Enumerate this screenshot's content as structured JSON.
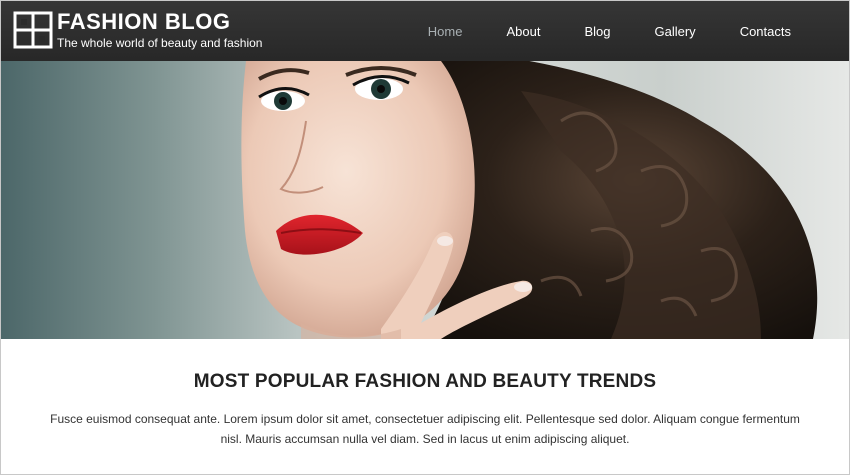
{
  "brand": {
    "title": "FASHION  BLOG",
    "tagline": "The whole world of beauty and fashion",
    "logo_icon": "fb-monogram-icon"
  },
  "nav": {
    "items": [
      {
        "label": "Home",
        "active": true
      },
      {
        "label": "About",
        "active": false
      },
      {
        "label": "Blog",
        "active": false
      },
      {
        "label": "Gallery",
        "active": false
      },
      {
        "label": "Contacts",
        "active": false
      }
    ]
  },
  "hero": {
    "image": "portrait-of-woman-with-curly-hair-and-red-lips"
  },
  "section": {
    "title": "MOST POPULAR FASHION AND BEAUTY TRENDS",
    "body": "Fusce euismod consequat ante. Lorem ipsum dolor sit amet, consectetuer adipiscing elit. Pellentesque sed dolor. Aliquam congue fermentum nisl. Mauris accumsan nulla vel diam. Sed in lacus ut enim adipiscing aliquet."
  },
  "colors": {
    "header_bg": "#2b2b2b",
    "nav_active": "#a9b0b3",
    "lip_red": "#d41a22",
    "hair": "#2a1f18"
  }
}
